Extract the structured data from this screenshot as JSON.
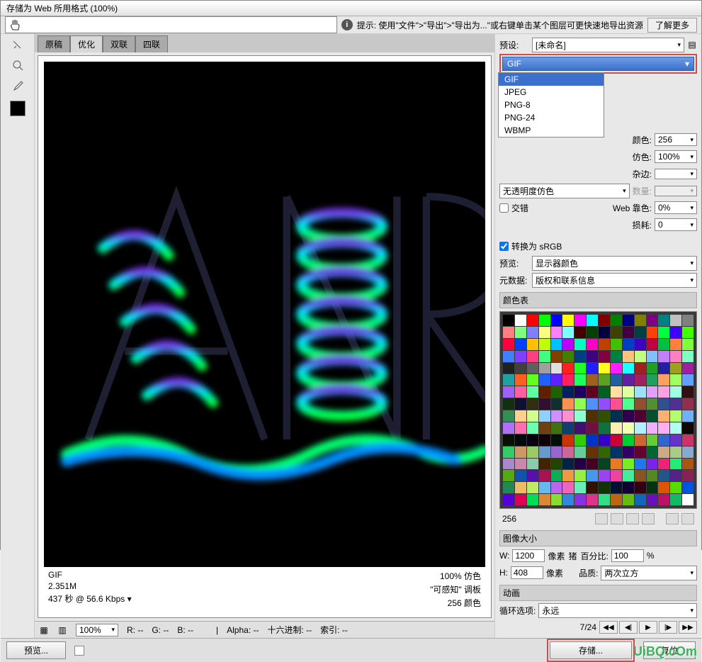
{
  "title": "存储为 Web 所用格式 (100%)",
  "hint": {
    "text": "提示: 使用\"文件\">\"导出\">\"导出为...\"或右键单击某个图层可更快速地导出资源",
    "learn_more": "了解更多"
  },
  "tabs": {
    "t0": "原稿",
    "t1": "优化",
    "t2": "双联",
    "t3": "四联"
  },
  "info": {
    "format": "GIF",
    "size": "2.351M",
    "timing_prefix": "437 秒 @ 56.6 Kbps",
    "dither_pct": "100% 仿色",
    "palette_label": "\"可感知\"   调板",
    "colors_label": "256 颜色"
  },
  "status": {
    "zoom": "100%",
    "r": "R: --",
    "g": "G: --",
    "b": "B: --",
    "alpha": "Alpha: --",
    "hex": "十六进制: --",
    "index": "索引: --"
  },
  "right": {
    "preset_label": "预设:",
    "preset_value": "[未命名]",
    "format_value": "GIF",
    "format_options": {
      "o0": "GIF",
      "o1": "JPEG",
      "o2": "PNG-8",
      "o3": "PNG-24",
      "o4": "WBMP"
    },
    "colors_label": "颜色:",
    "colors_value": "256",
    "dither_label": "仿色:",
    "dither_value": "100%",
    "matte_label": "杂边:",
    "trans_dither_label": "无透明度仿色",
    "amount_label": "数量:",
    "interlace_label": "交错",
    "web_label": "Web 靠色:",
    "web_value": "0%",
    "lossy_label": "损耗:",
    "lossy_value": "0",
    "convert_srgb": "转换为 sRGB",
    "preview_label": "预览:",
    "preview_value": "显示器颜色",
    "metadata_label": "元数据:",
    "metadata_value": "版权和联系信息",
    "colortable_title": "颜色表",
    "colortable_count": "256",
    "imagesize_title": "图像大小",
    "w_label": "W:",
    "w_value": "1200",
    "h_label": "H:",
    "h_value": "408",
    "px": "像素",
    "percent_label": "百分比:",
    "percent_value": "100",
    "pct_sign": "%",
    "quality_label": "品质:",
    "quality_value": "两次立方",
    "anim_title": "动画",
    "loop_label": "循环选项:",
    "loop_value": "永远",
    "frame": "7/24"
  },
  "bottom": {
    "preview_btn": "预览...",
    "save_btn": "存储...",
    "reset_btn": "复位"
  },
  "watermark": "UiBQ.cOm",
  "swatches": [
    "#000000",
    "#ffffff",
    "#ff0000",
    "#00ff00",
    "#0000ff",
    "#ffff00",
    "#ff00ff",
    "#00ffff",
    "#800000",
    "#008000",
    "#000080",
    "#808000",
    "#800080",
    "#008080",
    "#c0c0c0",
    "#808080",
    "#ff8080",
    "#80ff80",
    "#8080ff",
    "#ffff80",
    "#ff80ff",
    "#80ffff",
    "#400000",
    "#004000",
    "#000040",
    "#404000",
    "#400040",
    "#004040",
    "#ff4000",
    "#00ff40",
    "#4000ff",
    "#40ff00",
    "#ff0040",
    "#0040ff",
    "#ffc000",
    "#c0ff00",
    "#00c0ff",
    "#c000ff",
    "#00ffc0",
    "#ff00c0",
    "#c04000",
    "#40c000",
    "#0040c0",
    "#4000c0",
    "#c00040",
    "#00c040",
    "#ff8040",
    "#80ff40",
    "#4080ff",
    "#8040ff",
    "#ff4080",
    "#40ff80",
    "#804000",
    "#408000",
    "#004080",
    "#400080",
    "#800040",
    "#008040",
    "#ffc080",
    "#c0ff80",
    "#80c0ff",
    "#c080ff",
    "#ff80c0",
    "#80ffc0",
    "#202020",
    "#404040",
    "#606060",
    "#a0a0a0",
    "#e0e0e0",
    "#ff2020",
    "#20ff20",
    "#2020ff",
    "#ffff20",
    "#ff20ff",
    "#20ffff",
    "#a02020",
    "#20a020",
    "#2020a0",
    "#a0a020",
    "#a020a0",
    "#20a0a0",
    "#ff6020",
    "#60ff20",
    "#2060ff",
    "#6020ff",
    "#ff2060",
    "#20ff60",
    "#a06020",
    "#60a020",
    "#2060a0",
    "#6020a0",
    "#a02060",
    "#20a060",
    "#ffa060",
    "#a0ff60",
    "#60a0ff",
    "#a060ff",
    "#ff60a0",
    "#60ffa0",
    "#602000",
    "#206000",
    "#002060",
    "#200060",
    "#600020",
    "#006020",
    "#ffe0a0",
    "#e0ffa0",
    "#a0e0ff",
    "#e0a0ff",
    "#ffa0e0",
    "#a0ffe0",
    "#301010",
    "#103010",
    "#101030",
    "#303010",
    "#301030",
    "#103030",
    "#ff9050",
    "#90ff50",
    "#5090ff",
    "#9050ff",
    "#ff5090",
    "#50ff90",
    "#905030",
    "#509030",
    "#305090",
    "#503090",
    "#903050",
    "#309050",
    "#ffd090",
    "#d0ff90",
    "#90d0ff",
    "#d090ff",
    "#ff90d0",
    "#90ffd0",
    "#503000",
    "#305000",
    "#003050",
    "#300050",
    "#500030",
    "#005030",
    "#ffb070",
    "#b0ff70",
    "#70b0ff",
    "#b070ff",
    "#ff70b0",
    "#70ffb0",
    "#704010",
    "#407010",
    "#104070",
    "#401070",
    "#701040",
    "#107040",
    "#fff0b0",
    "#f0ffb0",
    "#b0f0ff",
    "#f0b0ff",
    "#ffb0f0",
    "#b0fff0",
    "#100800",
    "#081000",
    "#000810",
    "#080010",
    "#100008",
    "#001008",
    "#cc3300",
    "#33cc00",
    "#0033cc",
    "#3300cc",
    "#cc0033",
    "#00cc33",
    "#cc6633",
    "#66cc33",
    "#3366cc",
    "#6633cc",
    "#cc3366",
    "#33cc66",
    "#cc9966",
    "#99cc66",
    "#6699cc",
    "#9966cc",
    "#cc6699",
    "#66cc99",
    "#663300",
    "#336600",
    "#003366",
    "#330066",
    "#660033",
    "#006633",
    "#ccaa88",
    "#aacc88",
    "#88aacc",
    "#aa88cc",
    "#cc88aa",
    "#88ccaa",
    "#442200",
    "#224400",
    "#002244",
    "#220044",
    "#440022",
    "#004422",
    "#ee7722",
    "#77ee22",
    "#2277ee",
    "#7722ee",
    "#ee2277",
    "#22ee77",
    "#aa5511",
    "#55aa11",
    "#1155aa",
    "#5511aa",
    "#aa1155",
    "#11aa55",
    "#ee9944",
    "#99ee44",
    "#4499ee",
    "#9944ee",
    "#ee4499",
    "#44ee99",
    "#885522",
    "#558822",
    "#225588",
    "#552288",
    "#882255",
    "#228855",
    "#eebb66",
    "#bbee66",
    "#66bbee",
    "#bb66ee",
    "#ee66bb",
    "#66eebb",
    "#331100",
    "#113300",
    "#001133",
    "#110033",
    "#330011",
    "#003311",
    "#dd5500",
    "#55dd00",
    "#0055dd",
    "#5500dd",
    "#dd0055",
    "#00dd55",
    "#dd8833",
    "#88dd33",
    "#3388dd",
    "#8833dd",
    "#dd3388",
    "#33dd88",
    "#bb6611",
    "#66bb11",
    "#1166bb",
    "#6611bb",
    "#bb1166",
    "#11bb66",
    "#ffffff"
  ]
}
